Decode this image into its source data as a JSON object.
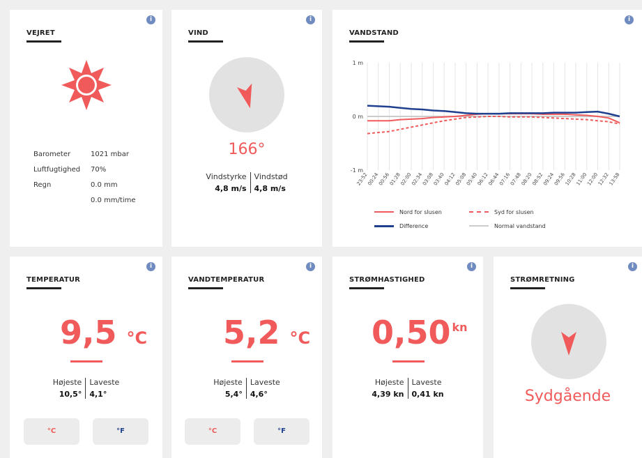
{
  "weather": {
    "title": "VEJRET",
    "rows": [
      {
        "label": "Barometer",
        "value": "1021 mbar"
      },
      {
        "label": "Luftfugtighed",
        "value": "70%"
      },
      {
        "label": "Regn",
        "value": "0.0 mm"
      },
      {
        "label": "",
        "value": "0.0 mm/time"
      }
    ]
  },
  "wind": {
    "title": "VIND",
    "degrees": "166°",
    "direction_deg": 166,
    "left_label": "Vindstyrke",
    "left_value": "4,8 m/s",
    "right_label": "Vindstød",
    "right_value": "4,8 m/s"
  },
  "waterlevel": {
    "title": "VANDSTAND",
    "legend": {
      "north": "Nord for slusen",
      "south": "Syd for slusen",
      "difference": "Difference",
      "normal": "Normal vandstand"
    }
  },
  "chart_data": {
    "type": "line",
    "title": "VANDSTAND",
    "ytick_labels": [
      "1 m",
      "0 m",
      "-1 m"
    ],
    "yticks": [
      1,
      0,
      -1
    ],
    "ylim": [
      -1,
      1
    ],
    "grid": true,
    "legend_position": "bottom",
    "categories": [
      "23:52",
      "00:24",
      "00:56",
      "01:28",
      "02:00",
      "02:34",
      "03:08",
      "03:40",
      "04:12",
      "05:08",
      "05:40",
      "06:12",
      "06:44",
      "07:16",
      "07:48",
      "08:20",
      "08:52",
      "09:24",
      "09:56",
      "10:28",
      "11:00",
      "12:00",
      "12:32",
      "13:58"
    ],
    "series": [
      {
        "name": "Nord for slusen",
        "color": "#f15a5a",
        "dash": false,
        "values": [
          -0.08,
          -0.08,
          -0.08,
          -0.06,
          -0.05,
          -0.04,
          -0.02,
          -0.01,
          0.0,
          0.02,
          0.04,
          0.05,
          0.05,
          0.05,
          0.05,
          0.05,
          0.04,
          0.04,
          0.04,
          0.03,
          0.02,
          0.0,
          -0.03,
          -0.12
        ]
      },
      {
        "name": "Syd for slusen",
        "color": "#f15a5a",
        "dash": true,
        "values": [
          -0.32,
          -0.3,
          -0.28,
          -0.24,
          -0.2,
          -0.16,
          -0.12,
          -0.08,
          -0.05,
          -0.02,
          -0.01,
          0.0,
          0.0,
          -0.01,
          -0.01,
          -0.01,
          -0.02,
          -0.03,
          -0.04,
          -0.05,
          -0.06,
          -0.08,
          -0.1,
          -0.14
        ]
      },
      {
        "name": "Difference",
        "color": "#1f3f8f",
        "dash": false,
        "values": [
          0.2,
          0.19,
          0.18,
          0.16,
          0.14,
          0.13,
          0.11,
          0.1,
          0.08,
          0.06,
          0.05,
          0.05,
          0.05,
          0.06,
          0.06,
          0.06,
          0.06,
          0.07,
          0.07,
          0.07,
          0.08,
          0.09,
          0.05,
          0.0
        ]
      },
      {
        "name": "Normal vandstand",
        "color": "#cccccc",
        "dash": false,
        "values": [
          0,
          0,
          0,
          0,
          0,
          0,
          0,
          0,
          0,
          0,
          0,
          0,
          0,
          0,
          0,
          0,
          0,
          0,
          0,
          0,
          0,
          0,
          0,
          0
        ]
      }
    ]
  },
  "temperature": {
    "title": "TEMPERATUR",
    "value": "9,5",
    "unit": "°C",
    "high_label": "Højeste",
    "high_value": "10,5°",
    "low_label": "Laveste",
    "low_value": "4,1°",
    "btn_c": "°C",
    "btn_f": "°F"
  },
  "watertemp": {
    "title": "VANDTEMPERATUR",
    "value": "5,2",
    "unit": "°C",
    "high_label": "Højeste",
    "high_value": "5,4°",
    "low_label": "Laveste",
    "low_value": "4,6°",
    "btn_c": "°C",
    "btn_f": "°F"
  },
  "current_speed": {
    "title": "STRØMHASTIGHED",
    "value": "0,50",
    "unit": "kn",
    "high_label": "Højeste",
    "high_value": "4,39 kn",
    "low_label": "Laveste",
    "low_value": "0,41 kn"
  },
  "current_direction": {
    "title": "STRØMRETNING",
    "direction_text": "Sydgående",
    "direction_deg": 180
  },
  "colors": {
    "accent": "#f15a5a",
    "navy": "#1f3f8f",
    "info": "#6f8bbf",
    "circle": "#e2e2e2"
  }
}
